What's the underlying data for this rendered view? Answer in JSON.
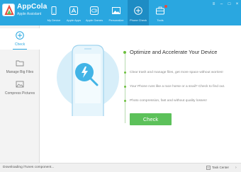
{
  "app": {
    "name": "AppCola",
    "subtitle": "Apple Assistant"
  },
  "nav": {
    "items": [
      {
        "label": "My Device",
        "icon": "device-icon"
      },
      {
        "label": "Apple Apps",
        "icon": "apps-icon"
      },
      {
        "label": "Apple Games",
        "icon": "games-icon"
      },
      {
        "label": "Personalize",
        "icon": "image-icon"
      },
      {
        "label": "Phone Check",
        "icon": "phone-check-icon",
        "active": true
      },
      {
        "label": "Tools",
        "icon": "toolbox-icon"
      }
    ]
  },
  "sidebar": {
    "items": [
      {
        "label": "Check",
        "icon": "plus-circle-icon",
        "active": true
      },
      {
        "label": "Manage Big Files",
        "icon": "folder-icon"
      },
      {
        "label": "Compress Pictures",
        "icon": "picture-icon"
      }
    ]
  },
  "main": {
    "title": "Optimize and Accelerate Your Device",
    "features": [
      "Clear trash and manage files, get more space without worries!",
      "Your Phone runs like a race horse or a snail? Check to find out.",
      "Photo compression, fast and without quality losses!"
    ],
    "check_button": "Check"
  },
  "status": {
    "text": "Downloading iTunes component...",
    "task_center": "Task Center"
  },
  "colors": {
    "header": "#2aa7e0",
    "accent_green": "#5cc15a",
    "illustration": "#cfeaf8"
  }
}
